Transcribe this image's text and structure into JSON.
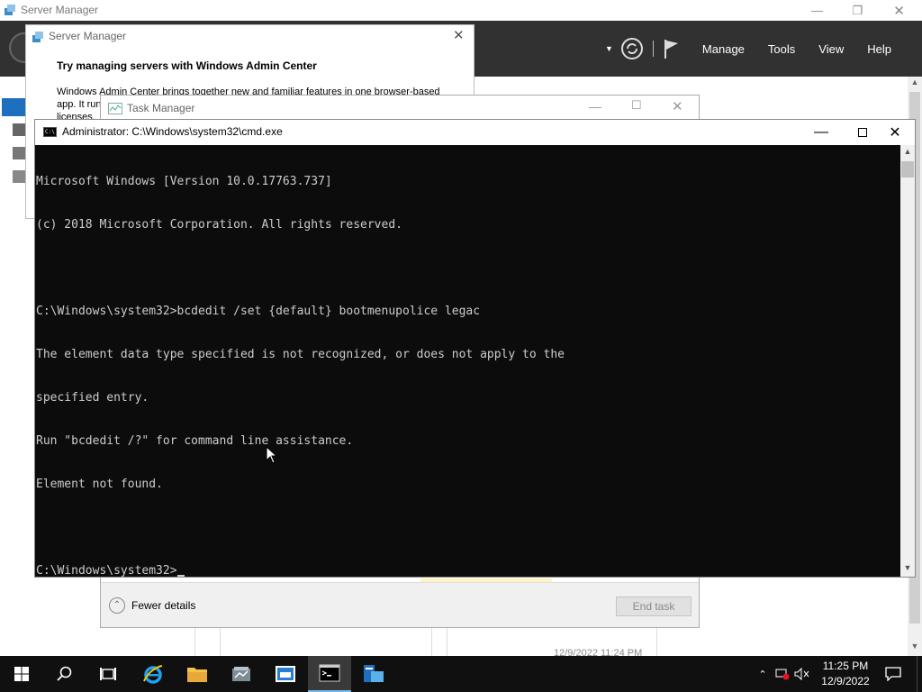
{
  "server_manager": {
    "window_title": "Server Manager",
    "header_menu": [
      "Manage",
      "Tools",
      "View",
      "Help"
    ],
    "timestamp_partial": "12/9/2022 11:24 PM"
  },
  "sm_popup": {
    "title": "Server Manager",
    "heading": "Try managing servers with Windows Admin Center",
    "body_line1": "Windows Admin Center brings together new and familiar features in one browser-based",
    "body_line2": "app. It run",
    "body_line3": "licenses."
  },
  "task_manager": {
    "title": "Task Manager",
    "fewer_details": "Fewer details",
    "end_task": "End task"
  },
  "cmd": {
    "title": "Administrator: C:\\Windows\\system32\\cmd.exe",
    "icon_text": "C:\\",
    "lines": [
      "Microsoft Windows [Version 10.0.17763.737]",
      "(c) 2018 Microsoft Corporation. All rights reserved.",
      "",
      "C:\\Windows\\system32>bcdedit /set {default} bootmenupolice legac",
      "The element data type specified is not recognized, or does not apply to the",
      "specified entry.",
      "Run \"bcdedit /?\" for command line assistance.",
      "Element not found.",
      "",
      "C:\\Windows\\system32>"
    ]
  },
  "taskbar": {
    "clock_time": "11:25 PM",
    "clock_date": "12/9/2022",
    "apps": [
      "start",
      "search",
      "task-view",
      "internet-explorer",
      "file-explorer",
      "task-manager",
      "server-manager",
      "cmd",
      "server-manager-2"
    ]
  },
  "colors": {
    "sm_header": "#313131",
    "console_bg": "#0c0c0c",
    "console_fg": "#cccccc",
    "taskbar": "#101010",
    "accent": "#76b9ed"
  }
}
